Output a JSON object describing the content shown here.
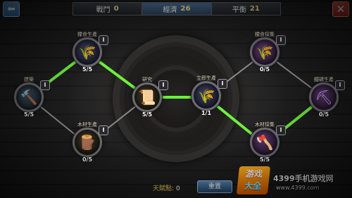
{
  "header": {
    "tabs": [
      {
        "label": "戰鬥",
        "value": "0",
        "active": false
      },
      {
        "label": "經濟",
        "value": "26",
        "active": true
      },
      {
        "label": "平衡",
        "value": "21",
        "active": false
      }
    ]
  },
  "nodes": [
    {
      "name": "建築",
      "level": "I",
      "progress": "5/5",
      "icon": "hammer-icon",
      "glyph": "🔨"
    },
    {
      "name": "糧食生產",
      "level": "I",
      "progress": "5/5",
      "icon": "wheat-icon",
      "glyph": "🌾"
    },
    {
      "name": "木材生產",
      "level": "I",
      "progress": "0/5",
      "icon": "wood-chest-icon",
      "glyph": "🪵"
    },
    {
      "name": "研究",
      "level": "I",
      "progress": "5/5",
      "icon": "scroll-icon",
      "glyph": "📜"
    },
    {
      "name": "立即生產",
      "level": "I",
      "progress": "1/1",
      "icon": "golden-wheat-icon",
      "glyph": "🌾"
    },
    {
      "name": "糧食採集",
      "level": "I",
      "progress": "0/5",
      "icon": "sickle-icon",
      "glyph": "🌾"
    },
    {
      "name": "木材採集",
      "level": "I",
      "progress": "5/5",
      "icon": "axe-icon",
      "glyph": "🪓"
    },
    {
      "name": "鐵礦生產",
      "level": "I",
      "progress": "0/5",
      "icon": "ore-cart-icon",
      "glyph": "⛏"
    }
  ],
  "footer": {
    "talent_label": "天賦點:",
    "talent_value": "0",
    "reset_label": "重置"
  },
  "watermark": {
    "logo_line1": "游戏",
    "logo_line2": "大全",
    "brand": "4399手机游戏网",
    "url": "www.4399.com"
  },
  "colors": {
    "link_active": "#6ff03c",
    "link_inactive": "#8a8a8a",
    "talent_label": "#e9c85a"
  }
}
